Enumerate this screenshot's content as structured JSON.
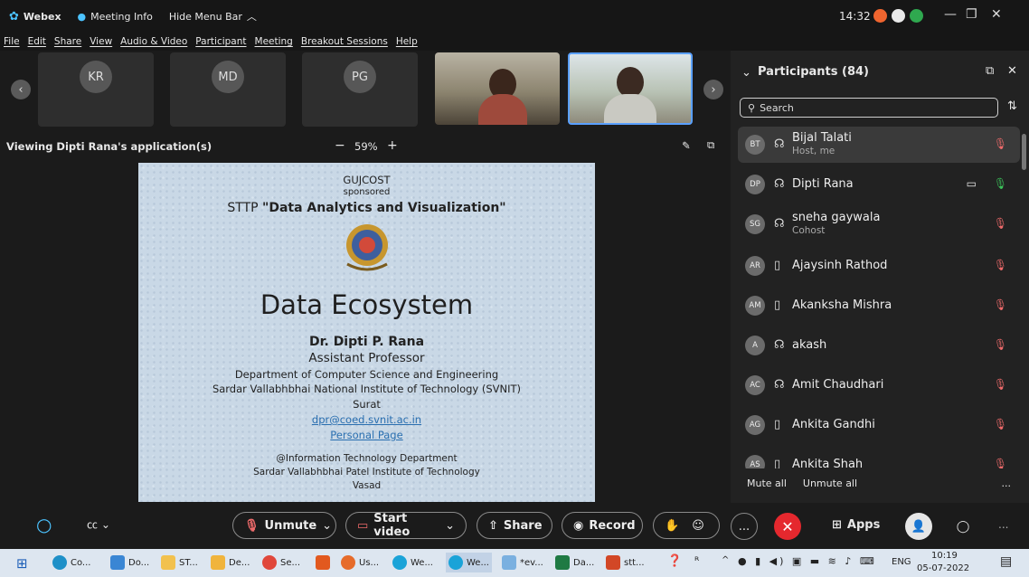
{
  "title_bar": {
    "app_name": "Webex",
    "meeting_info": "Meeting Info",
    "hide_menu_bar": "Hide Menu Bar",
    "chevron": "^",
    "clock": "14:32"
  },
  "menu": [
    "File",
    "Edit",
    "Share",
    "View",
    "Audio & Video",
    "Participant",
    "Meeting",
    "Breakout Sessions",
    "Help"
  ],
  "video_strip": {
    "tiles": [
      {
        "initials": "KR"
      },
      {
        "initials": "MD"
      },
      {
        "initials": "PG"
      }
    ],
    "prev": "‹",
    "next": "›"
  },
  "view_bar": {
    "label": "Viewing Dipti Rana's application(s)",
    "zoom_minus": "−",
    "zoom_value": "59%",
    "zoom_plus": "+"
  },
  "slide": {
    "org": "GUJCOST",
    "sponsored": "sponsored",
    "program_prefix": "STTP ",
    "program_title": "\"Data Analytics and Visualization\"",
    "heading": "Data Ecosystem",
    "presenter": "Dr. Dipti P. Rana",
    "position": "Assistant Professor",
    "department": "Department of Computer Science and Engineering",
    "institute": "Sardar Vallabhbhai National Institute of Technology (SVNIT)",
    "city": "Surat",
    "email": "dpr@coed.svnit.ac.in",
    "personal_page": "Personal Page",
    "venue_dept": "@Information Technology Department",
    "venue_inst": "Sardar Vallabhbhai Patel Institute of Technology",
    "venue_city": "Vasad"
  },
  "participants_panel": {
    "title": "Participants (84)",
    "search_placeholder": "Search",
    "participants": [
      {
        "initials": "BT",
        "name": "Bijal Talati",
        "role": "Host, me",
        "device": "headset",
        "mic": "muted"
      },
      {
        "initials": "DP",
        "name": "Dipti Rana",
        "role": "",
        "device": "headset",
        "mic": "active",
        "video": true
      },
      {
        "initials": "SG",
        "name": "sneha gaywala",
        "role": "Cohost",
        "device": "headset",
        "mic": "muted"
      },
      {
        "initials": "AR",
        "name": "Ajaysinh Rathod",
        "role": "",
        "device": "mobile",
        "mic": "muted"
      },
      {
        "initials": "AM",
        "name": "Akanksha Mishra",
        "role": "",
        "device": "mobile",
        "mic": "muted"
      },
      {
        "initials": "A",
        "name": "akash",
        "role": "",
        "device": "headset",
        "mic": "muted"
      },
      {
        "initials": "AC",
        "name": "Amit Chaudhari",
        "role": "",
        "device": "headset",
        "mic": "muted"
      },
      {
        "initials": "AG",
        "name": "Ankita Gandhi",
        "role": "",
        "device": "mobile",
        "mic": "muted"
      },
      {
        "initials": "AS",
        "name": "Ankita Shah",
        "role": "",
        "device": "mobile",
        "mic": "muted"
      }
    ],
    "mute_all": "Mute all",
    "unmute_all": "Unmute all",
    "more": "..."
  },
  "controls": {
    "unmute": "Unmute",
    "start_video": "Start video",
    "share": "Share",
    "record": "Record",
    "apps": "Apps",
    "more": "...",
    "leave_color": "#e5282e"
  },
  "taskbar": {
    "items": [
      "Co...",
      "Do...",
      "ST...",
      "De...",
      "Se...",
      "Us...",
      "We...",
      "We...",
      "*ev...",
      "Da...",
      "stt..."
    ],
    "lang": "ENG",
    "time": "10:19",
    "date": "05-07-2022"
  }
}
